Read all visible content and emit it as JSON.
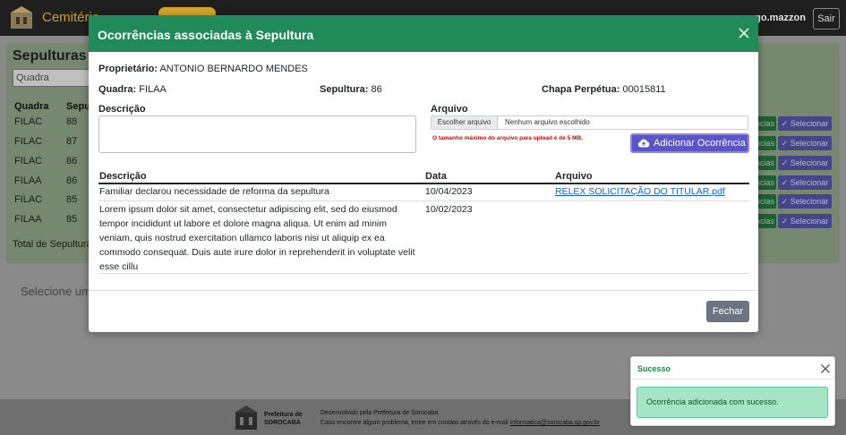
{
  "navbar": {
    "title": "Cemitério",
    "user": "go.mazzon",
    "logout": "Sair"
  },
  "background": {
    "panel_title": "Sepulturas",
    "search_placeholder": "Quadra",
    "headers": [
      "Quadra",
      "Sepu"
    ],
    "rows": [
      {
        "quadra": "FILAC",
        "sepultura": "88"
      },
      {
        "quadra": "FILAC",
        "sepultura": "87"
      },
      {
        "quadra": "FILAC",
        "sepultura": "86"
      },
      {
        "quadra": "FILAA",
        "sepultura": "86"
      },
      {
        "quadra": "FILAC",
        "sepultura": "85"
      },
      {
        "quadra": "FILAA",
        "sepultura": "85"
      }
    ],
    "row_btn_partial": "ncias",
    "row_select": "Selecionar",
    "total": "Total de Sepulturas",
    "select_hint": "Selecione uma"
  },
  "modal": {
    "title": "Ocorrências associadas à Sepultura",
    "owner_label": "Proprietário:",
    "owner_value": "ANTONIO BERNARDO MENDES",
    "quadra_label": "Quadra:",
    "quadra_value": "FILAA",
    "sepultura_label": "Sepultura:",
    "sepultura_value": "86",
    "chapa_label": "Chapa Perpétua:",
    "chapa_value": "00015811",
    "desc_label": "Descrição",
    "file_label": "Arquivo",
    "file_button": "Escolher arquivo",
    "file_none": "Nenhum arquivo escolhido",
    "file_hint": "O tamanho máximo do arquivo para upload é de 5 MB.",
    "add_button": "Adicionar Ocorrência",
    "table": {
      "headers": [
        "Descrição",
        "Data",
        "Arquivo"
      ],
      "rows": [
        {
          "descricao": "Familiar declarou necessidade de reforma da sepultura",
          "data": "10/04/2023",
          "arquivo": "RELEX SOLICITAÇÃO DO TITULAR.pdf"
        },
        {
          "descricao_lines": [
            "Lorem ipsum dolor sit amet, consectetur adipiscing elit, sed do eiusmod",
            "tempor incididunt ut labore et dolore magna aliqua. Ut enim ad minim",
            "veniam, quis nostrud exercitation ullamco laboris nisi ut aliquip ex ea",
            "commodo consequat. Duis aute irure dolor in reprehenderit in voluptate velit",
            "esse cillu"
          ],
          "data": "10/02/2023",
          "arquivo": ""
        }
      ]
    },
    "close_button": "Fechar"
  },
  "toast": {
    "title": "Sucesso",
    "message": "Ocorrência adicionada com sucesso."
  },
  "footer": {
    "brand_line1": "Prefeitura de",
    "brand_line2": "SOROCABA",
    "line1": "Desenvolvido pela Prefeitura de Sorocaba.",
    "line2_prefix": "Caso encontre algum problema, entre em contato através do e-mail ",
    "email": "informatica@sorocaba.sp.gov.br"
  },
  "colors": {
    "modal_header": "#218a59",
    "add_button": "#5a55c9",
    "close_button": "#6c757d",
    "toast_title": "#1e8a3f",
    "link": "#1a5fd0"
  }
}
